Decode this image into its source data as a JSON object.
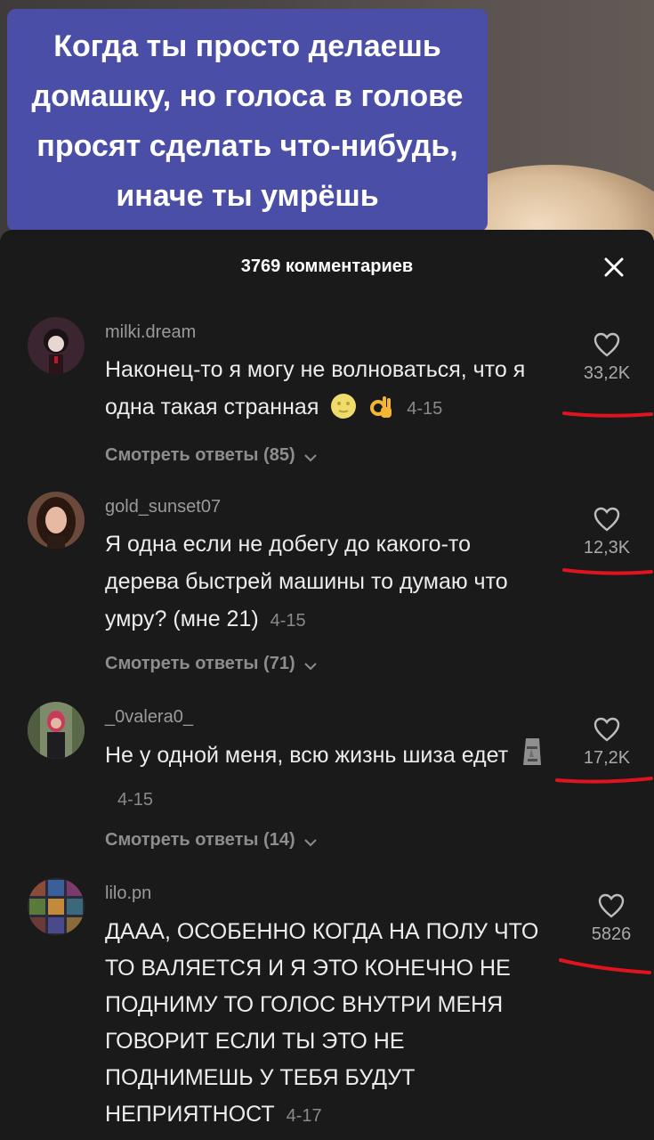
{
  "video": {
    "caption": "Когда ты просто делаешь домашку, но голоса в голове просят сделать что-нибудь, иначе ты умрёшь"
  },
  "sheet": {
    "title": "3769 комментариев",
    "close_icon": "close-icon"
  },
  "comments": [
    {
      "username": "milki.dream",
      "text": "Наконец-то я могу не волноваться, что я одна такая странная",
      "emoji": [
        "moon-face-emoji",
        "ok-hand-emoji"
      ],
      "date": "4-15",
      "likes": "33,2K",
      "replies": "Смотреть ответы (85)"
    },
    {
      "username": "gold_sunset07",
      "text": "Я одна если не добегу до какого-то дерева быстрей машины то думаю что умру? (мне 21)",
      "date": "4-15",
      "likes": "12,3K",
      "replies": "Смотреть ответы (71)"
    },
    {
      "username": "_0valera0_",
      "text": "Не у одной меня, всю жизнь шиза едет",
      "emoji": [
        "moai-emoji"
      ],
      "date": "4-15",
      "likes": "17,2K",
      "replies": "Смотреть ответы (14)"
    },
    {
      "username": "lilo.pn",
      "text": "ДААА, ОСОБЕННО КОГДА НА ПОЛУ ЧТО ТО ВАЛЯЕТСЯ И Я ЭТО КОНЕЧНО НЕ ПОДНИМУ ТО ГОЛОС ВНУТРИ МЕНЯ ГОВОРИТ ЕСЛИ ТЫ ЭТО НЕ ПОДНИМЕШЬ У ТЕБЯ БУДУТ НЕПРИЯТНОСТ",
      "date": "4-17",
      "likes": "5826"
    }
  ],
  "colors": {
    "sheet_bg": "#1a1a1b",
    "caption_bg": "#4b4ea6",
    "annotation_red": "#e0141e"
  }
}
